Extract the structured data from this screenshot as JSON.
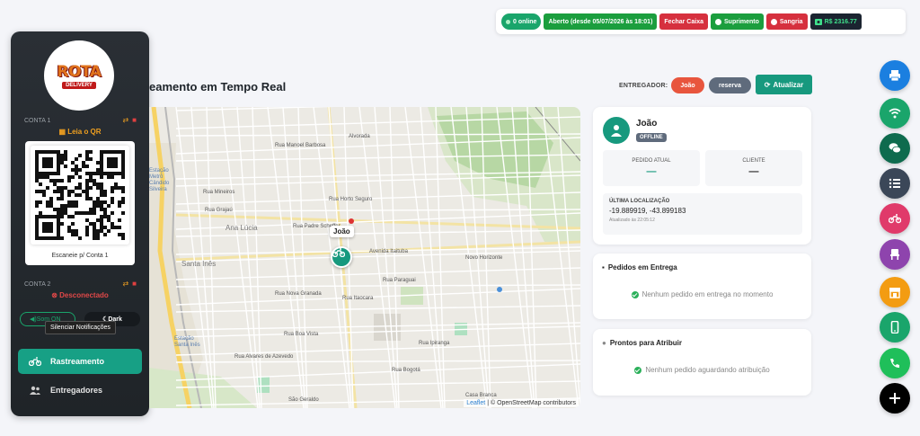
{
  "topbar": {
    "online": "0 online",
    "open_status": "Aberto (desde 05/07/2026 às 18:01)",
    "close_label": "Fechar Caixa",
    "supply_label": "Suprimento",
    "bleed_label": "Sangria",
    "balance": "R$ 2316.77",
    "colors": {
      "green": "#1b9e3e",
      "red": "#d6303e",
      "dark": "#1b2430"
    }
  },
  "sidebar": {
    "logo_text": "ROTA",
    "logo_sub": "DELIVERY",
    "account1_label": "CONTA 1",
    "qr_title": "Leia o QR",
    "qr_caption": "Escaneie p/ Conta 1",
    "account2_label": "CONTA 2",
    "account2_status": "Desconectado",
    "sound_label": "Som ON",
    "dark_label": "Dark",
    "tooltip": "Silenciar Notificações",
    "nav": [
      {
        "label": "Rastreamento",
        "icon": "motorcycle-icon",
        "active": true
      },
      {
        "label": "Entregadores",
        "icon": "users-icon",
        "active": false
      }
    ]
  },
  "header": {
    "title": "eamento em Tempo Real",
    "driver_filter_label": "ENTREGADOR:",
    "filters": [
      "João",
      "reserva"
    ],
    "refresh_label": "Atualizar"
  },
  "map": {
    "marker_label": "João",
    "neighborhoods": [
      "Ana Lúcia",
      "Santa Inês",
      "Novo Horizonte",
      "São Geraldo",
      "Casa Branca",
      "Alvorada"
    ],
    "station_labels": [
      "Estação Metrô Cândido Silveira",
      "Estação Santa Inês"
    ],
    "streets": [
      "Rua Manoel Barbosa",
      "Rua Horto Seguro",
      "Rua Padre Scheffer",
      "Rua Boa Vista",
      "Avenida Itaituba",
      "Rua Mineiros",
      "Rua Grajaú",
      "Rua Paraguai",
      "Rua Itaocara",
      "Rua Nova Granada",
      "Rua Bogotá",
      "Rua Alvares de Azevedo",
      "Rua Ipiranga"
    ],
    "attribution_leaflet": "Leaflet",
    "attribution_sep": " | © ",
    "attribution_osm": "OpenStreetMap contributors"
  },
  "driver_card": {
    "name": "João",
    "status": "OFFLINE",
    "current_order_label": "PEDIDO ATUAL",
    "current_order_value": "—",
    "client_label": "CLIENTE",
    "client_value": "—",
    "last_location_label": "ÚLTIMA LOCALIZAÇÃO",
    "coordinates": "-19.889919, -43.899183",
    "updated": "Atualizado às 22:05:12"
  },
  "orders_card": {
    "title": "Pedidos em Entrega",
    "empty": "Nenhum pedido em entrega no momento"
  },
  "ready_card": {
    "title": "Prontos para Atribuir",
    "empty": "Nenhum pedido aguardando atribuição"
  },
  "fabs": [
    {
      "icon": "printer-icon",
      "color": "#1b7fe0"
    },
    {
      "icon": "wifi-icon",
      "color": "#1aa56b"
    },
    {
      "icon": "chat-icon",
      "color": "#0e6b4e"
    },
    {
      "icon": "list-icon",
      "color": "#3b4758"
    },
    {
      "icon": "motorcycle-icon",
      "color": "#e03a6a"
    },
    {
      "icon": "chair-icon",
      "color": "#8e44ad"
    },
    {
      "icon": "store-icon",
      "color": "#f39c12"
    },
    {
      "icon": "phone-mobile-icon",
      "color": "#1aa56b"
    },
    {
      "icon": "phone-icon",
      "color": "#1fbf5a"
    },
    {
      "icon": "plus-icon",
      "color": "#000000"
    }
  ]
}
